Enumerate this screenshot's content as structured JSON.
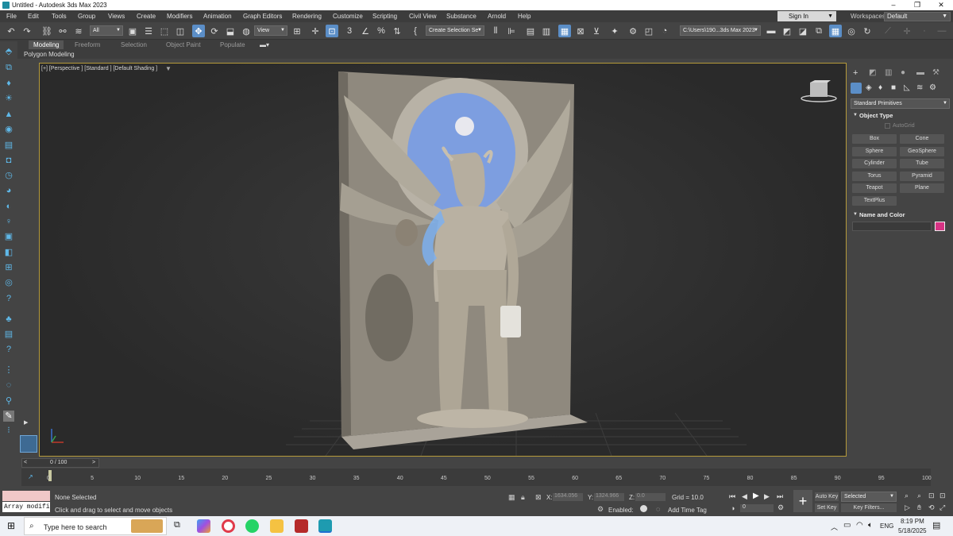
{
  "window": {
    "title": "Untitled - Autodesk 3ds Max 2023",
    "minimize": "–",
    "maximize": "❐",
    "close": "✕"
  },
  "menu": [
    "File",
    "Edit",
    "Tools",
    "Group",
    "Views",
    "Create",
    "Modifiers",
    "Animation",
    "Graph Editors",
    "Rendering",
    "Customize",
    "Scripting",
    "Civil View",
    "Substance",
    "Arnold",
    "Help"
  ],
  "account": {
    "sign_in": "Sign In",
    "workspace_label": "Workspaces:",
    "workspace_value": "Default"
  },
  "toolbar": {
    "selection_filter": "All",
    "ref_coord": "View",
    "named_selection": "Create Selection Se",
    "project_path": "C:\\Users\\190...3ds Max 2023"
  },
  "ribbon": {
    "tabs": [
      "Modeling",
      "Freeform",
      "Selection",
      "Object Paint",
      "Populate"
    ],
    "active_tab": "Modeling",
    "sub_label": "Polygon Modeling"
  },
  "viewport": {
    "label": "[+] [Perspective ] [Standard ] [Default Shading ]"
  },
  "command_panel": {
    "category": "Standard Primitives",
    "object_type_title": "Object Type",
    "autogrid": "AutoGrid",
    "buttons": [
      "Box",
      "Cone",
      "Sphere",
      "GeoSphere",
      "Cylinder",
      "Tube",
      "Torus",
      "Pyramid",
      "Teapot",
      "Plane",
      "TextPlus"
    ],
    "name_color_title": "Name and Color",
    "object_color": "#d63384"
  },
  "timeline": {
    "frame_display": "0 / 100",
    "ticks": [
      "0",
      "5",
      "10",
      "15",
      "20",
      "25",
      "30",
      "35",
      "40",
      "45",
      "50",
      "55",
      "60",
      "65",
      "70",
      "75",
      "80",
      "85",
      "90",
      "95",
      "100"
    ]
  },
  "status": {
    "maxscript_text": "Array modifi",
    "selection": "None Selected",
    "prompt": "Click and drag to select and move objects",
    "x_label": "X:",
    "x_value": "1634.056",
    "y_label": "Y:",
    "y_value": "1324.966",
    "z_label": "Z:",
    "z_value": "0.0",
    "grid": "Grid = 10.0",
    "enabled": "Enabled:",
    "add_time_tag": "Add Time Tag",
    "auto_key": "Auto Key",
    "set_key": "Set Key",
    "key_mode": "Selected",
    "key_filters": "Key Filters...",
    "current_frame": "0"
  },
  "taskbar": {
    "search_placeholder": "Type here to search",
    "lang": "ENG",
    "time": "8:19 PM",
    "date": "5/18/2025"
  },
  "colors": {
    "accent": "#5b8ec7",
    "viewport_border": "#b59a3a",
    "relief_stone": "#9a9488",
    "halo_blue": "#7d9ee0"
  }
}
